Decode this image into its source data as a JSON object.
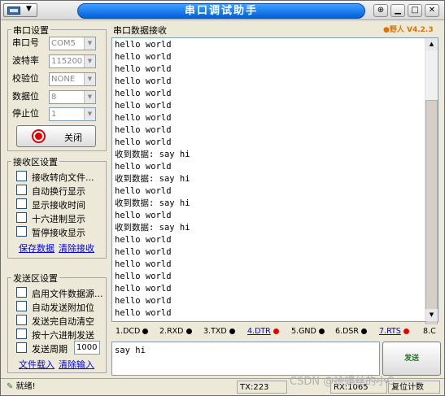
{
  "window": {
    "title": "串口调试助手",
    "version": "●野人 V4.2.3",
    "minimize_icon": "minimize-icon",
    "maximize_icon": "maximize-icon",
    "close_icon": "close-icon"
  },
  "port_settings": {
    "title": "串口设置",
    "port_label": "串口号",
    "port_value": "COM5",
    "baud_label": "波特率",
    "baud_value": "115200",
    "parity_label": "校验位",
    "parity_value": "NONE",
    "databits_label": "数据位",
    "databits_value": "8",
    "stopbits_label": "停止位",
    "stopbits_value": "1",
    "toggle_label": "关闭"
  },
  "receive_settings": {
    "title": "接收区设置",
    "options": [
      "接收转向文件...",
      "自动换行显示",
      "显示接收时间",
      "十六进制显示",
      "暂停接收显示"
    ],
    "save_link": "保存数据",
    "clear_link": "清除接收"
  },
  "send_settings": {
    "title": "发送区设置",
    "options": [
      "启用文件数据源...",
      "自动发送附加位",
      "发送完自动清空",
      "按十六进制发送",
      "发送周期"
    ],
    "period_value": "1000",
    "load_link": "文件载入",
    "clear_link": "清除输入"
  },
  "receive": {
    "title": "串口数据接收",
    "text": "hello world\nhello world\nhello world\nhello world\nhello world\nhello world\nhello world\nhello world\nhello world\n收到数据: say hi\nhello world\n收到数据: say hi\nhello world\n收到数据: say hi\nhello world\n收到数据: say hi\nhello world\nhello world\nhello world\nhello world\nhello world\nhello world\nhello world"
  },
  "lines": {
    "dcd": "1.DCD",
    "rxd": "2.RXD",
    "txd": "3.TXD",
    "dtr": "4.DTR",
    "gnd": "5.GND",
    "dsr": "6.DSR",
    "rts": "7.RTS",
    "c8": "8.C"
  },
  "send": {
    "text": "say hi",
    "button": "发送"
  },
  "statusbar": {
    "status": "就绪!",
    "tx": "TX:223",
    "rx": "RX:1065",
    "reset": "复位计数",
    "watermark": "CSDN @抢螺丝的小C"
  }
}
